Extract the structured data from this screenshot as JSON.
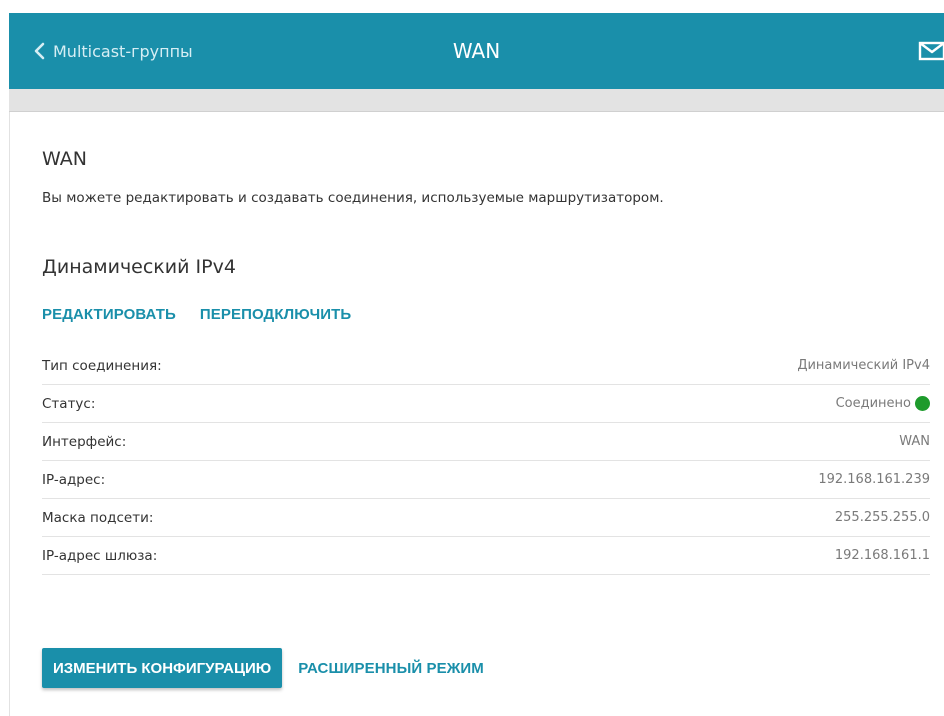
{
  "header": {
    "back_label": "Multicast-группы",
    "title": "WAN",
    "back_icon": "chevron-left-icon",
    "mail_icon": "mail-icon"
  },
  "page": {
    "title": "WAN",
    "description": "Вы можете редактировать и создавать соединения, используемые маршрутизатором."
  },
  "connection": {
    "name": "Динамический IPv4",
    "actions": {
      "edit": "РЕДАКТИРОВАТЬ",
      "reconnect": "ПЕРЕПОДКЛЮЧИТЬ"
    },
    "rows": [
      {
        "label": "Тип соединения:",
        "value": "Динамический IPv4"
      },
      {
        "label": "Статус:",
        "value": "Соединено",
        "status_color": "#1e9b2c"
      },
      {
        "label": "Интерфейс:",
        "value": "WAN"
      },
      {
        "label": "IP-адрес:",
        "value": "192.168.161.239"
      },
      {
        "label": "Маска подсети:",
        "value": "255.255.255.0"
      },
      {
        "label": "IP-адрес шлюза:",
        "value": "192.168.161.1"
      }
    ]
  },
  "footer_actions": {
    "change_config": "ИЗМЕНИТЬ КОНФИГУРАЦИЮ",
    "advanced_mode": "РАСШИРЕННЫЙ РЕЖИМ"
  },
  "colors": {
    "accent": "#1a8faa",
    "status_ok": "#1e9b2c"
  }
}
